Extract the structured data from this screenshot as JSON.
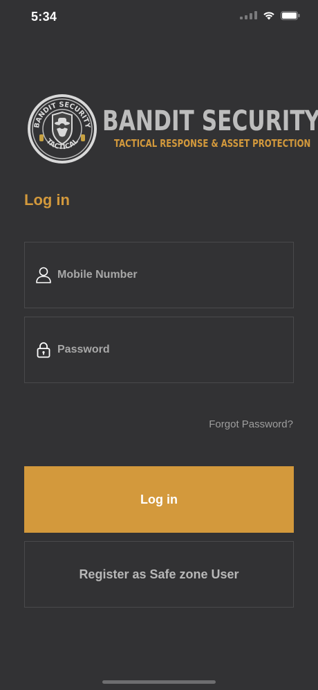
{
  "status_bar": {
    "time": "5:34"
  },
  "logo": {
    "seal_top_text": "BANDIT SECURITY",
    "seal_bottom_text": "TACTICAL",
    "title": "BANDIT SECURITY",
    "tagline": "TACTICAL RESPONSE & ASSET PROTECTION"
  },
  "login": {
    "heading": "Log in",
    "mobile_placeholder": "Mobile Number",
    "mobile_value": "",
    "password_placeholder": "Password",
    "password_value": "",
    "forgot_label": "Forgot Password?",
    "login_label": "Log in",
    "register_label": "Register as Safe zone User"
  },
  "colors": {
    "background": "#323234",
    "accent": "#d3993c",
    "field_border": "#4a4a4c"
  }
}
